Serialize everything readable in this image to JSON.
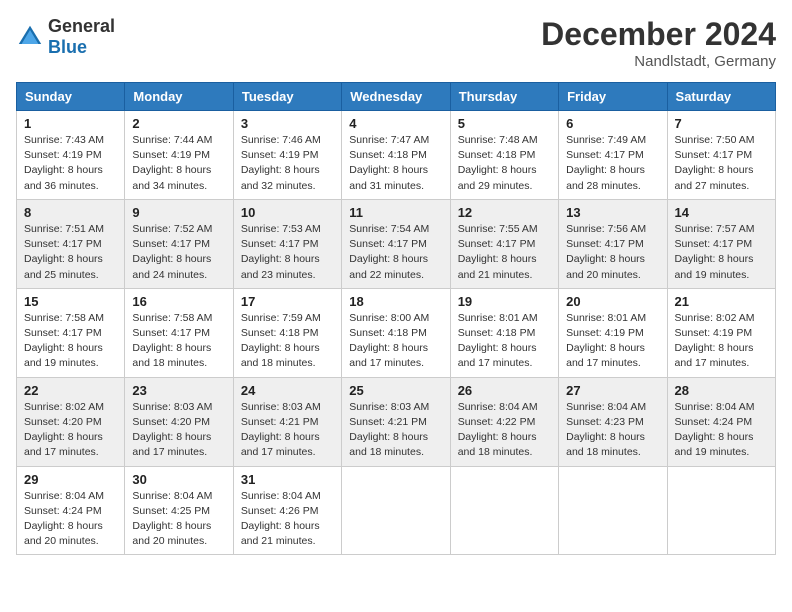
{
  "header": {
    "logo_general": "General",
    "logo_blue": "Blue",
    "month_title": "December 2024",
    "location": "Nandlstadt, Germany"
  },
  "days_of_week": [
    "Sunday",
    "Monday",
    "Tuesday",
    "Wednesday",
    "Thursday",
    "Friday",
    "Saturday"
  ],
  "weeks": [
    [
      {
        "day": 1,
        "sunrise": "7:43 AM",
        "sunset": "4:19 PM",
        "daylight": "8 hours and 36 minutes."
      },
      {
        "day": 2,
        "sunrise": "7:44 AM",
        "sunset": "4:19 PM",
        "daylight": "8 hours and 34 minutes."
      },
      {
        "day": 3,
        "sunrise": "7:46 AM",
        "sunset": "4:19 PM",
        "daylight": "8 hours and 32 minutes."
      },
      {
        "day": 4,
        "sunrise": "7:47 AM",
        "sunset": "4:18 PM",
        "daylight": "8 hours and 31 minutes."
      },
      {
        "day": 5,
        "sunrise": "7:48 AM",
        "sunset": "4:18 PM",
        "daylight": "8 hours and 29 minutes."
      },
      {
        "day": 6,
        "sunrise": "7:49 AM",
        "sunset": "4:17 PM",
        "daylight": "8 hours and 28 minutes."
      },
      {
        "day": 7,
        "sunrise": "7:50 AM",
        "sunset": "4:17 PM",
        "daylight": "8 hours and 27 minutes."
      }
    ],
    [
      {
        "day": 8,
        "sunrise": "7:51 AM",
        "sunset": "4:17 PM",
        "daylight": "8 hours and 25 minutes."
      },
      {
        "day": 9,
        "sunrise": "7:52 AM",
        "sunset": "4:17 PM",
        "daylight": "8 hours and 24 minutes."
      },
      {
        "day": 10,
        "sunrise": "7:53 AM",
        "sunset": "4:17 PM",
        "daylight": "8 hours and 23 minutes."
      },
      {
        "day": 11,
        "sunrise": "7:54 AM",
        "sunset": "4:17 PM",
        "daylight": "8 hours and 22 minutes."
      },
      {
        "day": 12,
        "sunrise": "7:55 AM",
        "sunset": "4:17 PM",
        "daylight": "8 hours and 21 minutes."
      },
      {
        "day": 13,
        "sunrise": "7:56 AM",
        "sunset": "4:17 PM",
        "daylight": "8 hours and 20 minutes."
      },
      {
        "day": 14,
        "sunrise": "7:57 AM",
        "sunset": "4:17 PM",
        "daylight": "8 hours and 19 minutes."
      }
    ],
    [
      {
        "day": 15,
        "sunrise": "7:58 AM",
        "sunset": "4:17 PM",
        "daylight": "8 hours and 19 minutes."
      },
      {
        "day": 16,
        "sunrise": "7:58 AM",
        "sunset": "4:17 PM",
        "daylight": "8 hours and 18 minutes."
      },
      {
        "day": 17,
        "sunrise": "7:59 AM",
        "sunset": "4:18 PM",
        "daylight": "8 hours and 18 minutes."
      },
      {
        "day": 18,
        "sunrise": "8:00 AM",
        "sunset": "4:18 PM",
        "daylight": "8 hours and 17 minutes."
      },
      {
        "day": 19,
        "sunrise": "8:01 AM",
        "sunset": "4:18 PM",
        "daylight": "8 hours and 17 minutes."
      },
      {
        "day": 20,
        "sunrise": "8:01 AM",
        "sunset": "4:19 PM",
        "daylight": "8 hours and 17 minutes."
      },
      {
        "day": 21,
        "sunrise": "8:02 AM",
        "sunset": "4:19 PM",
        "daylight": "8 hours and 17 minutes."
      }
    ],
    [
      {
        "day": 22,
        "sunrise": "8:02 AM",
        "sunset": "4:20 PM",
        "daylight": "8 hours and 17 minutes."
      },
      {
        "day": 23,
        "sunrise": "8:03 AM",
        "sunset": "4:20 PM",
        "daylight": "8 hours and 17 minutes."
      },
      {
        "day": 24,
        "sunrise": "8:03 AM",
        "sunset": "4:21 PM",
        "daylight": "8 hours and 17 minutes."
      },
      {
        "day": 25,
        "sunrise": "8:03 AM",
        "sunset": "4:21 PM",
        "daylight": "8 hours and 18 minutes."
      },
      {
        "day": 26,
        "sunrise": "8:04 AM",
        "sunset": "4:22 PM",
        "daylight": "8 hours and 18 minutes."
      },
      {
        "day": 27,
        "sunrise": "8:04 AM",
        "sunset": "4:23 PM",
        "daylight": "8 hours and 18 minutes."
      },
      {
        "day": 28,
        "sunrise": "8:04 AM",
        "sunset": "4:24 PM",
        "daylight": "8 hours and 19 minutes."
      }
    ],
    [
      {
        "day": 29,
        "sunrise": "8:04 AM",
        "sunset": "4:24 PM",
        "daylight": "8 hours and 20 minutes."
      },
      {
        "day": 30,
        "sunrise": "8:04 AM",
        "sunset": "4:25 PM",
        "daylight": "8 hours and 20 minutes."
      },
      {
        "day": 31,
        "sunrise": "8:04 AM",
        "sunset": "4:26 PM",
        "daylight": "8 hours and 21 minutes."
      },
      null,
      null,
      null,
      null
    ]
  ]
}
